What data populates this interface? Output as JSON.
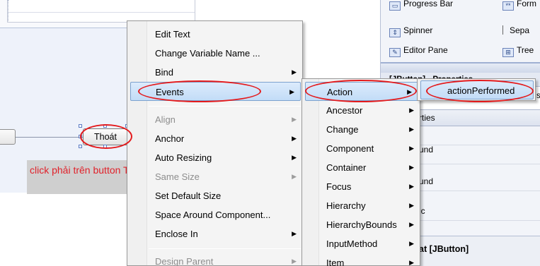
{
  "designer": {
    "button_label": "Thoát",
    "tip_text": "click phải trên button Thoát"
  },
  "palette": {
    "items": [
      {
        "label": "Progress Bar",
        "icon": "progress-bar-icon"
      },
      {
        "label": "Form",
        "icon": "formatted-field-icon"
      },
      {
        "label": "Spinner",
        "icon": "spinner-icon"
      },
      {
        "label": "Sepa",
        "icon": "separator-icon"
      },
      {
        "label": "Editor Pane",
        "icon": "editor-pane-icon"
      },
      {
        "label": "Tree",
        "icon": "tree-icon"
      }
    ]
  },
  "properties": {
    "title_fragment": "[JButton] - Properties",
    "row_fragment": "s",
    "header": "rties",
    "values": [
      "und",
      "und",
      "ic"
    ],
    "footer": "at [JButton]"
  },
  "context_menu": {
    "items": [
      {
        "label": "Edit Text",
        "disabled": false,
        "submenu": false
      },
      {
        "label": "Change Variable Name ...",
        "disabled": false,
        "submenu": false
      },
      {
        "label": "Bind",
        "disabled": false,
        "submenu": true
      },
      {
        "label": "Events",
        "disabled": false,
        "submenu": true,
        "highlighted": true
      },
      {
        "label": "Align",
        "disabled": true,
        "submenu": true
      },
      {
        "label": "Anchor",
        "disabled": false,
        "submenu": true
      },
      {
        "label": "Auto Resizing",
        "disabled": false,
        "submenu": true
      },
      {
        "label": "Same Size",
        "disabled": true,
        "submenu": true
      },
      {
        "label": "Set Default Size",
        "disabled": false,
        "submenu": false
      },
      {
        "label": "Space Around Component...",
        "disabled": false,
        "submenu": false
      },
      {
        "label": "Enclose In",
        "disabled": false,
        "submenu": true
      },
      {
        "label": "Design Parent",
        "disabled": true,
        "submenu": true
      }
    ]
  },
  "events_menu": {
    "items": [
      {
        "label": "Action",
        "highlighted": true
      },
      {
        "label": "Ancestor"
      },
      {
        "label": "Change"
      },
      {
        "label": "Component"
      },
      {
        "label": "Container"
      },
      {
        "label": "Focus"
      },
      {
        "label": "Hierarchy"
      },
      {
        "label": "HierarchyBounds"
      },
      {
        "label": "InputMethod"
      },
      {
        "label": "Item"
      }
    ]
  },
  "action_menu": {
    "items": [
      {
        "label": "actionPerformed"
      }
    ]
  },
  "colors": {
    "annotation_red": "#e41a1c",
    "tip_text": "#e0212a",
    "highlight": "#c2dcf7"
  }
}
